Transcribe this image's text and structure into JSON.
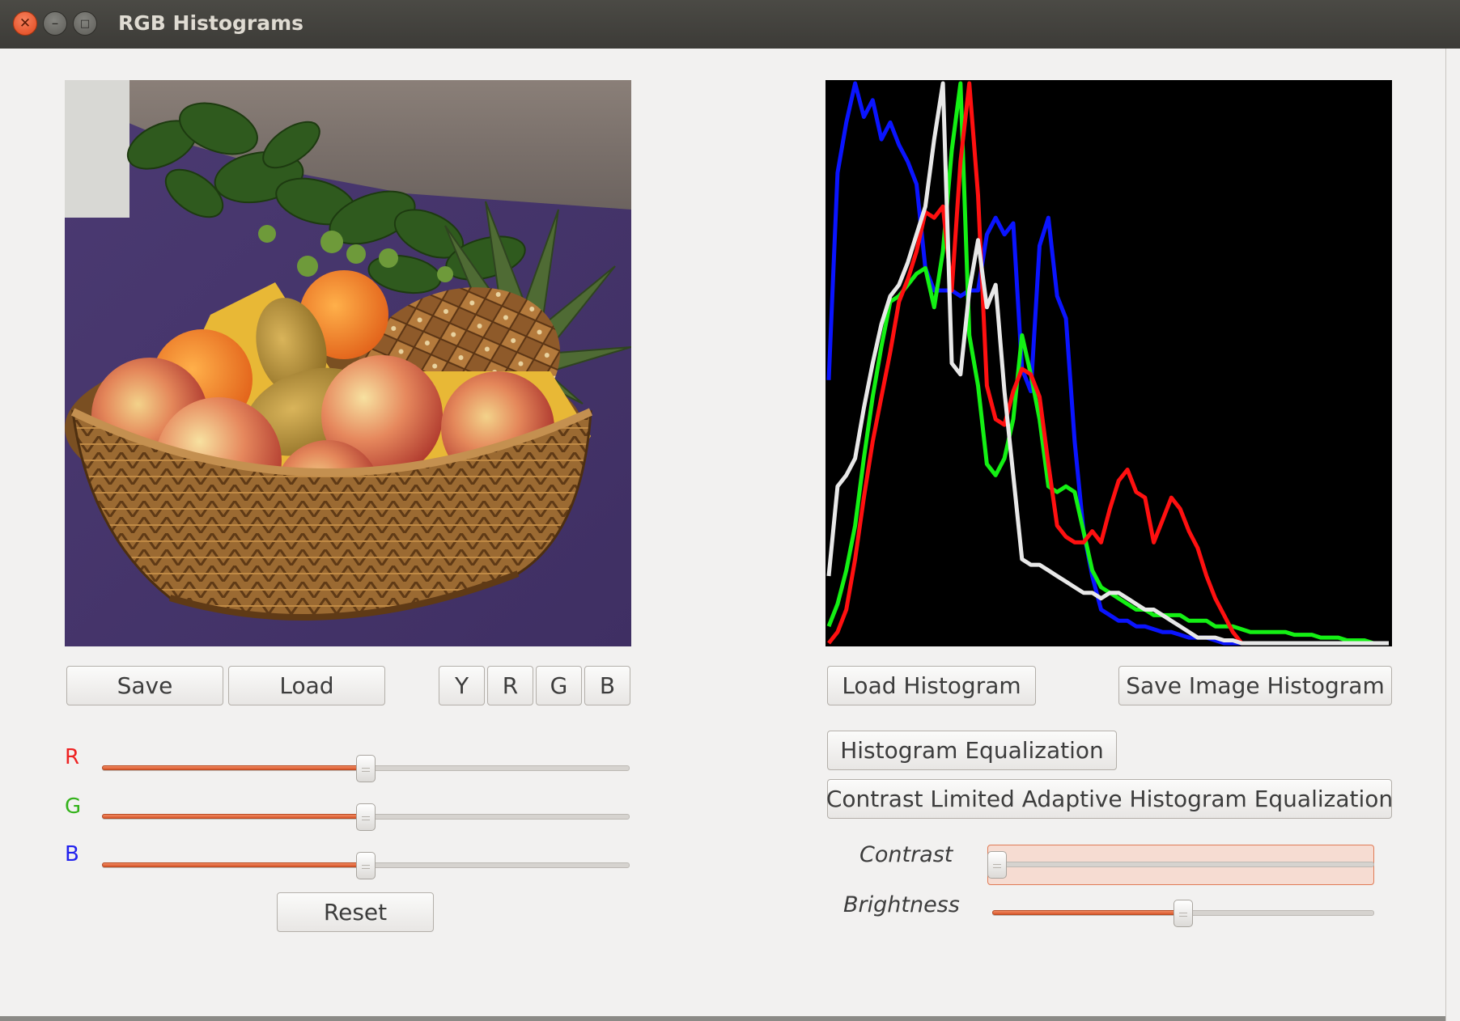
{
  "window": {
    "title": "RGB Histograms"
  },
  "left": {
    "buttons": {
      "save": "Save",
      "load": "Load",
      "y": "Y",
      "r": "R",
      "g": "G",
      "b": "B",
      "reset": "Reset"
    },
    "sliders": [
      {
        "label": "R",
        "color": "#ee2222",
        "value_fraction": 0.5
      },
      {
        "label": "G",
        "color": "#33b21a",
        "value_fraction": 0.5
      },
      {
        "label": "B",
        "color": "#2222ee",
        "value_fraction": 0.5
      }
    ]
  },
  "right": {
    "buttons": {
      "load_histogram": "Load Histogram",
      "save_image_histogram": "Save Image Histogram",
      "histogram_equalization": "Histogram Equalization",
      "clahe": "Contrast Limited Adaptive Histogram Equalization"
    },
    "contrast": {
      "label": "Contrast",
      "value_fraction": 0.0
    },
    "brightness": {
      "label": "Brightness",
      "value_fraction": 0.5
    }
  },
  "colors": {
    "accent": "#e2612f",
    "hist_bg": "#000000",
    "hist_blue": "#0a14ff",
    "hist_green": "#14f014",
    "hist_red": "#ff1010",
    "hist_white": "#e8e8e8"
  },
  "chart_data": {
    "type": "line",
    "title": "",
    "xlabel": "",
    "ylabel": "",
    "xlim": [
      0,
      255
    ],
    "ylim": [
      0,
      1
    ],
    "grid": false,
    "series": [
      {
        "color": "#0a14ff",
        "x": [
          0,
          4,
          8,
          12,
          16,
          20,
          24,
          28,
          32,
          36,
          40,
          44,
          48,
          52,
          56,
          60,
          64,
          68,
          72,
          76,
          80,
          84,
          88,
          92,
          96,
          100,
          104,
          108,
          112,
          116,
          120,
          124,
          128,
          132,
          136,
          140,
          144,
          148,
          152,
          156,
          160,
          164,
          168,
          172,
          176,
          180,
          184,
          188,
          192,
          196,
          200,
          204,
          208,
          212,
          216,
          220,
          224,
          228,
          232,
          236,
          240,
          244,
          248,
          252,
          255
        ],
        "y": [
          0.47,
          0.84,
          0.93,
          1.0,
          0.94,
          0.97,
          0.9,
          0.93,
          0.89,
          0.86,
          0.82,
          0.67,
          0.63,
          0.63,
          0.63,
          0.62,
          0.63,
          0.63,
          0.73,
          0.76,
          0.73,
          0.75,
          0.49,
          0.45,
          0.71,
          0.76,
          0.62,
          0.58,
          0.36,
          0.2,
          0.12,
          0.06,
          0.05,
          0.04,
          0.04,
          0.03,
          0.03,
          0.025,
          0.02,
          0.02,
          0.015,
          0.01,
          0.01,
          0.01,
          0.005,
          0.0,
          0.0,
          0.0,
          0.0,
          0.0,
          0.0,
          0.0,
          0.0,
          0.0,
          0.0,
          0.0,
          0.0,
          0.0,
          0.0,
          0.0,
          0.0,
          0.0,
          0.0,
          0.0,
          0.0
        ]
      },
      {
        "color": "#14f014",
        "x": [
          0,
          4,
          8,
          12,
          16,
          20,
          24,
          28,
          32,
          36,
          40,
          44,
          48,
          52,
          56,
          60,
          64,
          68,
          72,
          76,
          80,
          84,
          88,
          92,
          96,
          100,
          104,
          108,
          112,
          116,
          120,
          124,
          128,
          132,
          136,
          140,
          144,
          148,
          152,
          156,
          160,
          164,
          168,
          172,
          176,
          180,
          184,
          188,
          192,
          196,
          200,
          204,
          208,
          212,
          216,
          220,
          224,
          228,
          232,
          236,
          240,
          244,
          248,
          252,
          255
        ],
        "y": [
          0.03,
          0.07,
          0.13,
          0.21,
          0.33,
          0.44,
          0.53,
          0.61,
          0.62,
          0.64,
          0.66,
          0.67,
          0.6,
          0.7,
          0.88,
          1.0,
          0.55,
          0.46,
          0.32,
          0.3,
          0.33,
          0.4,
          0.55,
          0.48,
          0.4,
          0.28,
          0.27,
          0.28,
          0.27,
          0.2,
          0.13,
          0.1,
          0.09,
          0.08,
          0.07,
          0.06,
          0.06,
          0.05,
          0.05,
          0.05,
          0.05,
          0.04,
          0.04,
          0.04,
          0.03,
          0.03,
          0.03,
          0.025,
          0.02,
          0.02,
          0.02,
          0.02,
          0.02,
          0.015,
          0.015,
          0.015,
          0.01,
          0.01,
          0.01,
          0.005,
          0.005,
          0.005,
          0.0,
          0.0,
          0.0
        ]
      },
      {
        "color": "#ff1010",
        "x": [
          0,
          4,
          8,
          12,
          16,
          20,
          24,
          28,
          32,
          36,
          40,
          44,
          48,
          52,
          56,
          60,
          64,
          68,
          72,
          76,
          80,
          84,
          88,
          92,
          96,
          100,
          104,
          108,
          112,
          116,
          120,
          124,
          128,
          132,
          136,
          140,
          144,
          148,
          152,
          156,
          160,
          164,
          168,
          172,
          176,
          180,
          184,
          188,
          192,
          196,
          200,
          204,
          208,
          212,
          216,
          220,
          224,
          228,
          232,
          236,
          240,
          244,
          248,
          252,
          255
        ],
        "y": [
          0.0,
          0.02,
          0.06,
          0.15,
          0.26,
          0.36,
          0.44,
          0.52,
          0.61,
          0.65,
          0.7,
          0.77,
          0.76,
          0.78,
          0.63,
          0.86,
          1.0,
          0.8,
          0.46,
          0.4,
          0.39,
          0.45,
          0.49,
          0.48,
          0.44,
          0.32,
          0.21,
          0.19,
          0.18,
          0.18,
          0.2,
          0.18,
          0.24,
          0.29,
          0.31,
          0.27,
          0.26,
          0.18,
          0.22,
          0.26,
          0.24,
          0.2,
          0.17,
          0.12,
          0.08,
          0.05,
          0.02,
          0.0,
          0.0,
          0.0,
          0.0,
          0.0,
          0.0,
          0.0,
          0.0,
          0.0,
          0.0,
          0.0,
          0.0,
          0.0,
          0.0,
          0.0,
          0.0,
          0.0,
          0.0
        ]
      },
      {
        "color": "#e8e8e8",
        "x": [
          0,
          4,
          8,
          12,
          16,
          20,
          24,
          28,
          32,
          36,
          40,
          44,
          48,
          52,
          56,
          60,
          64,
          68,
          72,
          76,
          80,
          84,
          88,
          92,
          96,
          100,
          104,
          108,
          112,
          116,
          120,
          124,
          128,
          132,
          136,
          140,
          144,
          148,
          152,
          156,
          160,
          164,
          168,
          172,
          176,
          180,
          184,
          188,
          192,
          196,
          200,
          204,
          208,
          212,
          216,
          220,
          224,
          228,
          232,
          236,
          240,
          244,
          248,
          252,
          255
        ],
        "y": [
          0.12,
          0.28,
          0.3,
          0.33,
          0.42,
          0.5,
          0.57,
          0.62,
          0.64,
          0.68,
          0.73,
          0.78,
          0.9,
          1.0,
          0.5,
          0.48,
          0.63,
          0.72,
          0.6,
          0.64,
          0.45,
          0.3,
          0.15,
          0.14,
          0.14,
          0.13,
          0.12,
          0.11,
          0.1,
          0.09,
          0.09,
          0.08,
          0.09,
          0.09,
          0.08,
          0.07,
          0.06,
          0.06,
          0.05,
          0.04,
          0.03,
          0.02,
          0.01,
          0.01,
          0.01,
          0.005,
          0.005,
          0.0,
          0.0,
          0.0,
          0.0,
          0.0,
          0.0,
          0.0,
          0.0,
          0.0,
          0.0,
          0.0,
          0.0,
          0.0,
          0.0,
          0.0,
          0.0,
          0.0,
          0.0
        ]
      }
    ]
  }
}
